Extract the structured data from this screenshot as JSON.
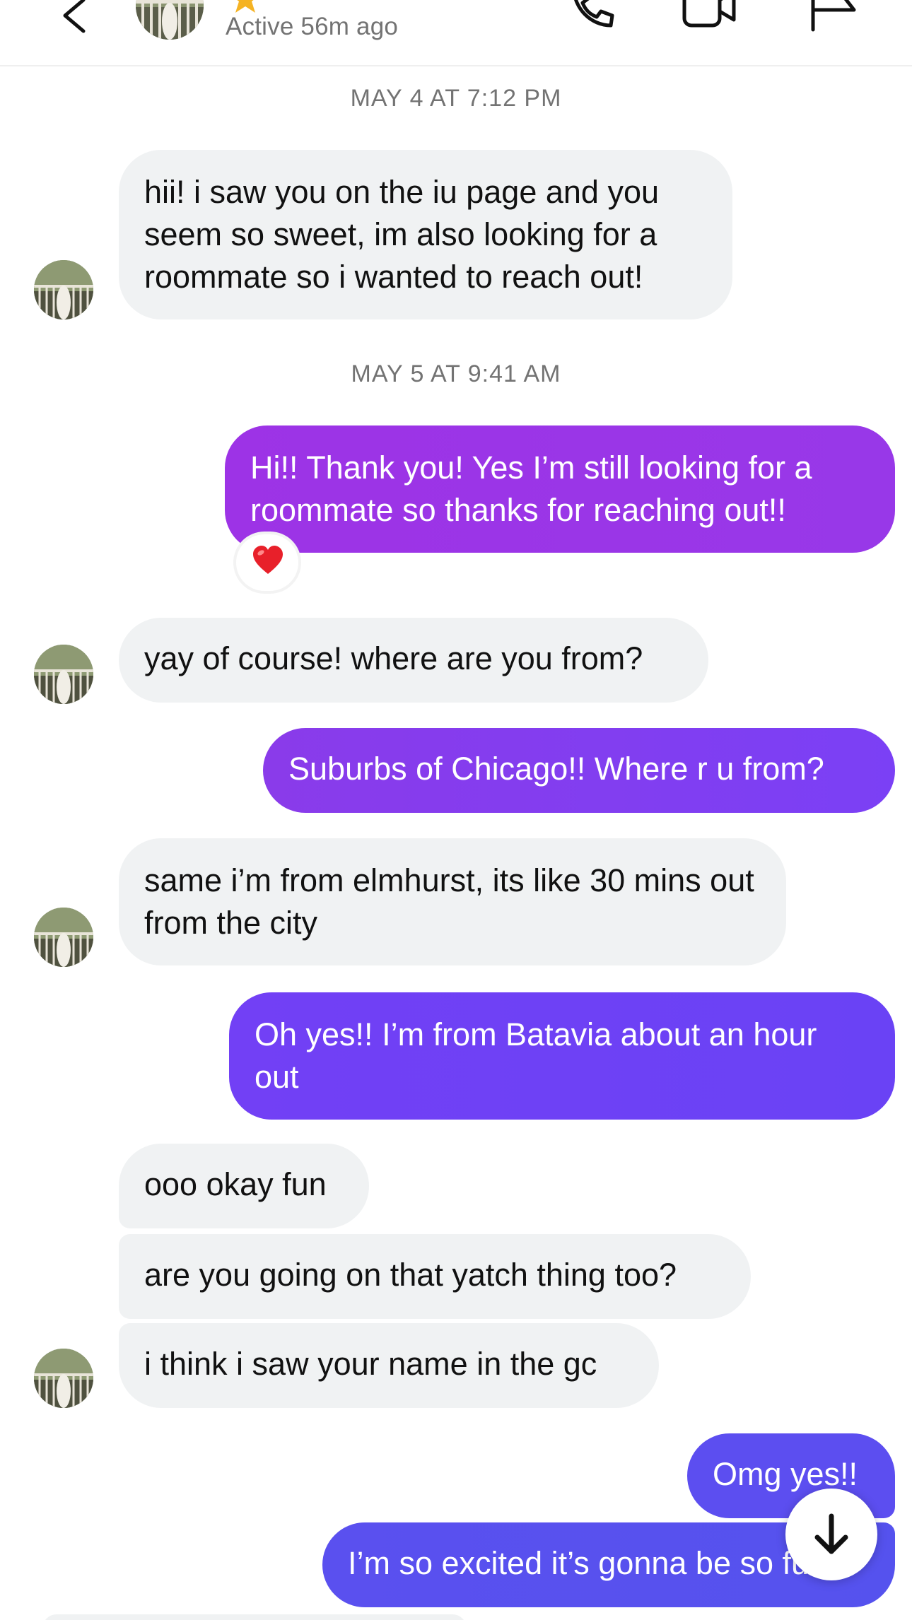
{
  "header": {
    "status": "Active 56m ago",
    "icons": [
      "back-arrow-icon",
      "avatar",
      "star-icon",
      "phone-icon",
      "video-icon",
      "flag-icon"
    ]
  },
  "timestamps": [
    "MAY 4 AT 7:12 PM",
    "MAY 5 AT 9:41 AM"
  ],
  "messages": [
    {
      "from": "them",
      "text": "hii! i saw you on the iu page and you seem so sweet, im also looking for a roommate so i wanted to reach out!"
    },
    {
      "from": "me",
      "text": "Hi!! Thank you! Yes I’m still looking for a roommate so thanks for reaching out!!",
      "reaction": "❤️"
    },
    {
      "from": "them",
      "text": "yay of course! where are you from?"
    },
    {
      "from": "me",
      "text": "Suburbs of Chicago!! Where r u from?"
    },
    {
      "from": "them",
      "text": "same i’m from elmhurst, its like 30 mins out from the city"
    },
    {
      "from": "me",
      "text": "Oh yes!! I’m from Batavia about an hour out"
    },
    {
      "from": "them",
      "text": "ooo okay fun"
    },
    {
      "from": "them",
      "text": "are you going on that yatch thing too?"
    },
    {
      "from": "them",
      "text": "i think i saw your name in the gc"
    },
    {
      "from": "me",
      "text": "Omg yes!!"
    },
    {
      "from": "me",
      "text": "I’m so excited it’s gonna be so fun"
    }
  ],
  "colors": {
    "received_bubble": "#f0f2f3",
    "sent_gradient": [
      "#9d33e6",
      "#9838e8",
      "#7b40f5",
      "#6a42f5",
      "#5c4ef0",
      "#5552ee"
    ],
    "secondary_text": "#737373"
  }
}
